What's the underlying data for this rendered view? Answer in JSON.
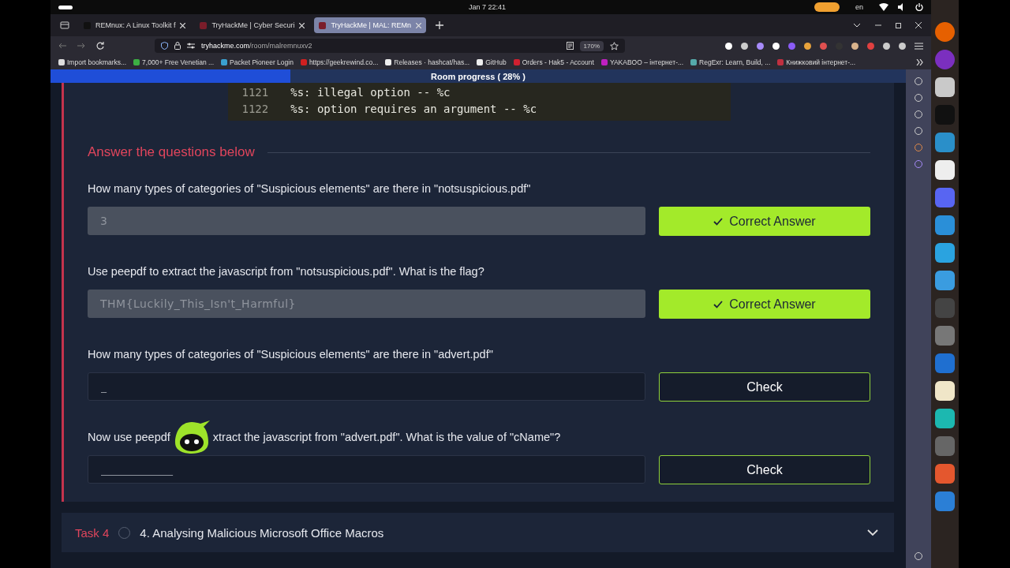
{
  "system_bar": {
    "clock": "Jan 7  22:41",
    "language": "en"
  },
  "browser": {
    "tabs": [
      {
        "title": "REMnux: A Linux Toolkit f",
        "selected": false
      },
      {
        "title": "TryHackMe | Cyber Securi",
        "selected": false
      },
      {
        "title": "TryHackMe | MAL: REMn",
        "selected": true
      }
    ],
    "address": {
      "domain": "tryhackme.com",
      "path": "/room/malremnuxv2"
    },
    "zoom": "170%",
    "bookmarks": [
      "Import bookmarks...",
      "7,000+ Free Venetian ...",
      "Packet Pioneer Login",
      "https://geekrewind.co...",
      "Releases · hashcat/has...",
      "GitHub",
      "Orders - Hak5 - Account",
      "YAKABOO – інтернет-...",
      "RegExr: Learn, Build, ...",
      "Книжковий інтернет-..."
    ]
  },
  "page": {
    "progress": {
      "label": "Room progress ( 28% )",
      "level": 0.28
    },
    "code_lines": [
      {
        "number": "1121",
        "text": "%s: illegal option -- %c"
      },
      {
        "number": "1122",
        "text": "%s: option requires an argument -- %c"
      }
    ],
    "section_title": "Answer the questions below",
    "questions": [
      {
        "text": [
          "How many types of categories of \"Suspicious elements\" are there in \"notsuspicious.pdf\""
        ],
        "answered": true,
        "value": "3",
        "button": "Correct Answer"
      },
      {
        "text": [
          "Use peepdf to extract the javascript from \"notsuspicious.pdf\". What is the flag?"
        ],
        "answered": true,
        "value": "THM{Luckily_This_Isn't_Harmful}",
        "button": "Correct Answer"
      },
      {
        "text": [
          "How many types of categories of \"Suspicious elements\" are there in \"advert.pdf\""
        ],
        "answered": false,
        "placeholder": "_",
        "button": "Check"
      },
      {
        "text": [
          "Now use peepdf",
          "xtract the javascript from \"advert.pdf\". What is the value of \"cName\"?"
        ],
        "answered": false,
        "placeholder": "_____________",
        "button": "Check"
      }
    ],
    "next_task": {
      "label": "Task 4",
      "title": "4. Analysing Malicious Microsoft Office Macros",
      "done": false
    }
  }
}
